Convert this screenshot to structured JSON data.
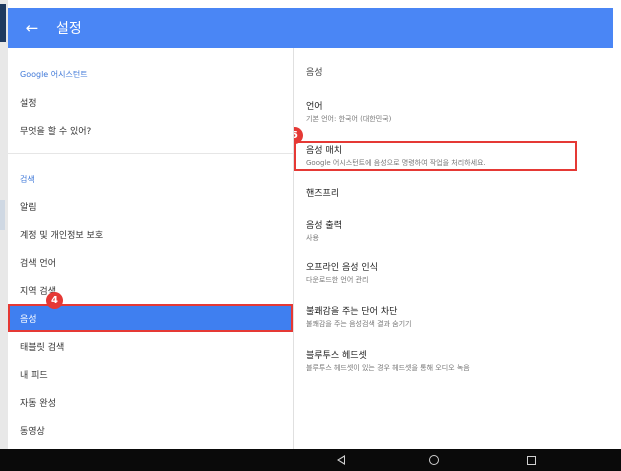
{
  "header": {
    "title": "설정",
    "back_icon": "arrow-left-icon",
    "color": "#4a86f5"
  },
  "left": {
    "section1": "Google 어시스턴트",
    "items1": [
      {
        "label": "설정"
      },
      {
        "label": "무엇을 할 수 있어?"
      }
    ],
    "section2": "검색",
    "items2": [
      {
        "label": "알림"
      },
      {
        "label": "계정 및 개인정보 보호"
      },
      {
        "label": "검색 언어"
      },
      {
        "label": "지역 검색"
      },
      {
        "label": "음성"
      },
      {
        "label": "태블릿 검색"
      },
      {
        "label": "내 피드"
      },
      {
        "label": "자동 완성"
      },
      {
        "label": "동영상"
      }
    ],
    "selected_color": "#3f7ff0"
  },
  "right": {
    "header": "음성",
    "prefs": [
      {
        "title": "언어",
        "subtitle": "기본 언어: 한국어 (대한민국)"
      },
      {
        "title": "음성 매치",
        "subtitle": "Google 어시스턴트에 음성으로 명령하여 작업을 처리하세요."
      },
      {
        "title": "핸즈프리",
        "subtitle": ""
      },
      {
        "title": "음성 출력",
        "subtitle": "사용"
      },
      {
        "title": "오프라인 음성 인식",
        "subtitle": "다운로드한 언어 관리"
      },
      {
        "title": "불쾌감을 주는 단어 차단",
        "subtitle": "불쾌감을 주는 음성검색 결과 숨기기"
      },
      {
        "title": "블루투스 헤드셋",
        "subtitle": "블루투스 헤드셋이 있는 경우 헤드셋을 통해 오디오 녹음"
      }
    ]
  },
  "badges": {
    "left": "4",
    "right": "5",
    "color": "#e53935"
  },
  "navbar": {
    "back_icon": "triangle-back-icon",
    "home_icon": "circle-home-icon",
    "recent_icon": "square-recents-icon"
  }
}
